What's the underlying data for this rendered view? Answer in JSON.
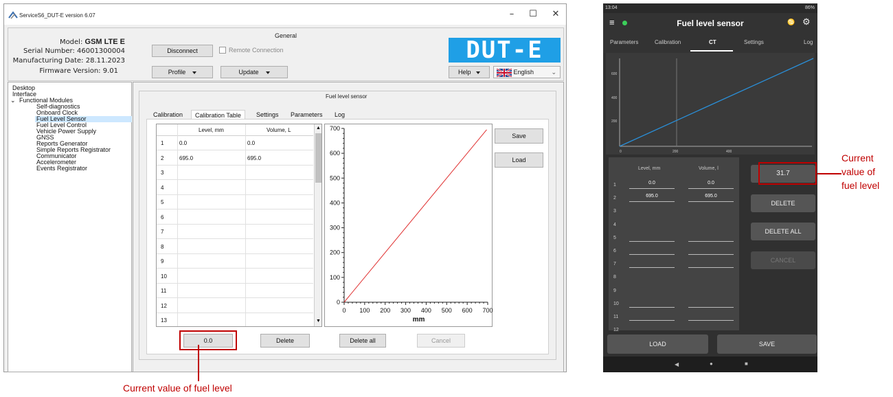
{
  "window": {
    "title": "ServiceS6_DUT-E version 6.07",
    "minimize": "–",
    "maximize": "☐",
    "close": "✕"
  },
  "general": {
    "title": "General",
    "model_label": "Model:",
    "model_value": "GSM LTE E",
    "serial_label": "Serial Number:",
    "serial_value": "46001300004",
    "mfg_label": "Manufacturing Date:",
    "mfg_value": "28.11.2023",
    "fw_label": "Firmware Version:",
    "fw_value": "9.01",
    "disconnect": "Disconnect",
    "remote": "Remote Connection",
    "profile": "Profile",
    "update": "Update",
    "help": "Help",
    "language": "English",
    "logo": "DUT-E"
  },
  "tree": {
    "items": [
      "Desktop",
      "Interface",
      "Functional Modules",
      "Self-diagnostics",
      "Onboard Clock",
      "Fuel Level Sensor",
      "Fuel Level Control",
      "Vehicle Power Supply",
      "GNSS",
      "Reports Generator",
      "Simple Reports Registrator",
      "Communicator",
      "Accelerometer",
      "Events Registrator"
    ]
  },
  "fls": {
    "title": "Fuel level sensor",
    "tabs": [
      "Calibration",
      "Calibration Table",
      "Settings",
      "Parameters",
      "Log"
    ],
    "col_level": "Level, mm",
    "col_volume": "Volume, L",
    "rows": [
      {
        "n": "1",
        "level": "0.0",
        "volume": "0.0"
      },
      {
        "n": "2",
        "level": "695.0",
        "volume": "695.0"
      },
      {
        "n": "3",
        "level": "",
        "volume": ""
      },
      {
        "n": "4",
        "level": "",
        "volume": ""
      },
      {
        "n": "5",
        "level": "",
        "volume": ""
      },
      {
        "n": "6",
        "level": "",
        "volume": ""
      },
      {
        "n": "7",
        "level": "",
        "volume": ""
      },
      {
        "n": "8",
        "level": "",
        "volume": ""
      },
      {
        "n": "9",
        "level": "",
        "volume": ""
      },
      {
        "n": "10",
        "level": "",
        "volume": ""
      },
      {
        "n": "11",
        "level": "",
        "volume": ""
      },
      {
        "n": "12",
        "level": "",
        "volume": ""
      },
      {
        "n": "13",
        "level": "",
        "volume": ""
      }
    ],
    "save": "Save",
    "load": "Load",
    "current_value": "0.0",
    "delete": "Delete",
    "delete_all": "Delete all",
    "cancel": "Cancel",
    "line_color": "#e03030"
  },
  "chart_data": {
    "type": "line",
    "x": [
      0,
      695
    ],
    "series": [
      {
        "values": [
          0,
          695
        ]
      }
    ],
    "xlabel": "mm",
    "ylabel": "",
    "xlim": [
      0,
      700
    ],
    "ylim": [
      0,
      700
    ],
    "xticks": [
      "0",
      "100",
      "200",
      "300",
      "400",
      "500",
      "600",
      "700"
    ],
    "yticks": [
      "0",
      "100",
      "200",
      "300",
      "400",
      "500",
      "600",
      "700"
    ],
    "grid": false
  },
  "phone": {
    "status_time": "13:04",
    "status_right": "86%",
    "title": "Fuel level sensor",
    "tabs": [
      "Parameters",
      "Calibration",
      "CT",
      "Settings",
      "Log"
    ],
    "chart_xticks": [
      "0",
      "200",
      "400"
    ],
    "chart_yticks": [
      "600",
      "400",
      "200"
    ],
    "col_level": "Level, mm",
    "col_volume": "Volume, l",
    "rows": [
      {
        "n": "1",
        "level": "0.0",
        "volume": "0.0"
      },
      {
        "n": "2",
        "level": "695.0",
        "volume": "695.0"
      },
      {
        "n": "3",
        "level": "",
        "volume": ""
      },
      {
        "n": "4",
        "level": "",
        "volume": ""
      },
      {
        "n": "5",
        "level": "",
        "volume": ""
      },
      {
        "n": "6",
        "level": "",
        "volume": ""
      },
      {
        "n": "7",
        "level": "",
        "volume": ""
      },
      {
        "n": "8",
        "level": "",
        "volume": ""
      },
      {
        "n": "9",
        "level": "",
        "volume": ""
      },
      {
        "n": "10",
        "level": "",
        "volume": ""
      },
      {
        "n": "11",
        "level": "",
        "volume": ""
      },
      {
        "n": "12",
        "level": "",
        "volume": ""
      }
    ],
    "current_value": "31.7",
    "delete": "DELETE",
    "delete_all": "DELETE ALL",
    "cancel": "CANCEL",
    "load": "LOAD",
    "save": "SAVE",
    "line_color": "#2a8fd8"
  },
  "annotations": {
    "desktop": "Current value of fuel level",
    "phone": "Current value of fuel level",
    "color": "#c00000"
  }
}
